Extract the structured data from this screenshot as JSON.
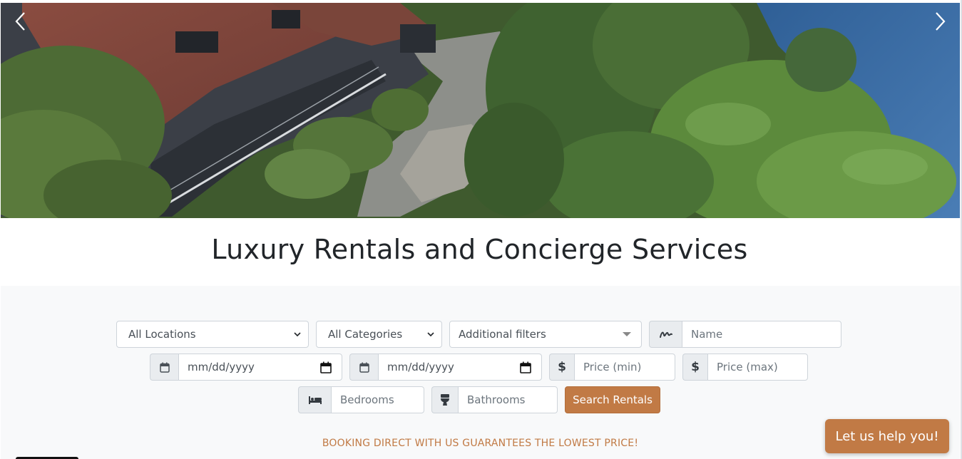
{
  "hero": {
    "prev_icon": "chevron-left-icon",
    "next_icon": "chevron-right-icon"
  },
  "page": {
    "title": "Luxury Rentals and Concierge Services"
  },
  "filters": {
    "location": {
      "value": "All Locations",
      "icon": "chevron-down-icon"
    },
    "category": {
      "value": "All Categories",
      "icon": "chevron-down-icon"
    },
    "additional": {
      "value": "Additional filters",
      "icon": "caret-down-icon"
    },
    "name": {
      "placeholder": "Name",
      "icon": "signature-icon"
    },
    "checkin": {
      "value": "mm/dd/yyyy",
      "icon": "calendar-icon"
    },
    "checkout": {
      "value": "mm/dd/yyyy",
      "icon": "calendar-icon"
    },
    "price_min": {
      "placeholder": "Price (min)",
      "icon": "dollar-icon"
    },
    "price_max": {
      "placeholder": "Price (max)",
      "icon": "dollar-icon"
    },
    "bedrooms": {
      "placeholder": "Bedrooms",
      "icon": "bed-icon"
    },
    "bathrooms": {
      "placeholder": "Bathrooms",
      "icon": "toilet-icon"
    },
    "search_label": "Search Rentals"
  },
  "guarantee_text": "BOOKING DIRECT WITH US GUARANTEES THE LOWEST PRICE!",
  "help_button": "Let us help you!",
  "colors": {
    "accent": "#c17a45",
    "section_bg": "#f8f9fa"
  }
}
